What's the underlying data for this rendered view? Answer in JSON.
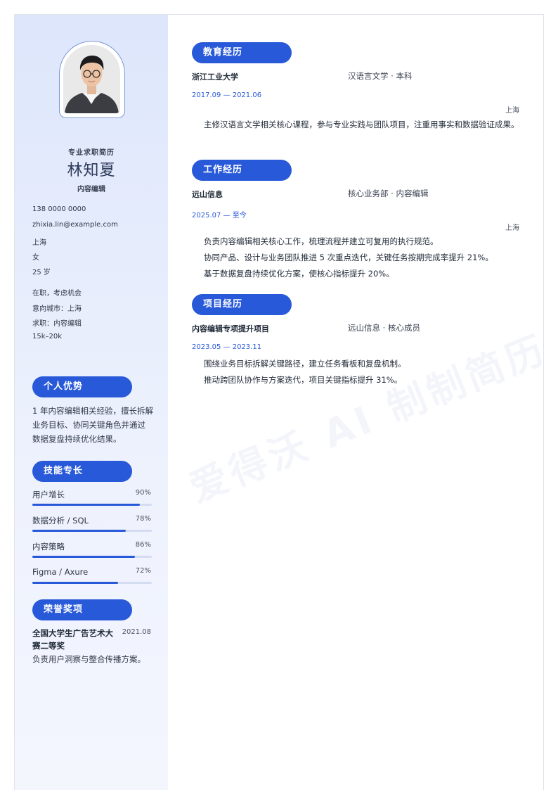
{
  "watermark": "爱得沃 AI 制制简历",
  "profile": {
    "subtitle": "专业求职简历",
    "name": "林知夏",
    "role": "内容编辑",
    "phone": "138 0000 0000",
    "email": "zhixia.lin@example.com",
    "city": "上海",
    "gender": "女",
    "age": "25 岁",
    "status": "在职，考虑机会",
    "target_city": "意向城市：上海",
    "target_job": "求职：内容编辑",
    "salary": "15k–20k"
  },
  "advantages": {
    "title": "个人优势",
    "text": "1 年内容编辑相关经验，擅长拆解业务目标、协同关键角色并通过数据复盘持续优化结果。"
  },
  "skills": {
    "title": "技能专长",
    "items": [
      {
        "name": "用户增长",
        "percent_label": "90%",
        "level": 0.9
      },
      {
        "name": "数据分析 / SQL",
        "percent_label": "78%",
        "level": 0.78
      },
      {
        "name": "内容策略",
        "percent_label": "86%",
        "level": 0.86
      },
      {
        "name": "Figma / Axure",
        "percent_label": "72%",
        "level": 0.72
      }
    ]
  },
  "awards": {
    "title": "荣誉奖项",
    "items": [
      {
        "name": "全国大学生广告艺术大赛二等奖",
        "date": "2021.08",
        "desc": "负责用户洞察与整合传播方案。"
      }
    ]
  },
  "education": {
    "title": "教育经历",
    "school": "浙江工业大学",
    "major": "汉语言文学 · 本科",
    "period": "2017.09 — 2021.06",
    "location": "上海",
    "desc": "主修汉语言文学相关核心课程，参与专业实践与团队项目，注重用事实和数据验证成果。"
  },
  "work": {
    "title": "工作经历",
    "company": "远山信息",
    "dept": "核心业务部 · 内容编辑",
    "period": "2025.07 — 至今",
    "location": "上海",
    "bullets": [
      "负责内容编辑相关核心工作，梳理流程并建立可复用的执行规范。",
      "协同产品、设计与业务团队推进 5 次重点迭代，关键任务按期完成率提升 21%。",
      "基于数据复盘持续优化方案，使核心指标提升 20%。"
    ]
  },
  "project": {
    "title": "项目经历",
    "name": "内容编辑专项提升项目",
    "org": "远山信息 · 核心成员",
    "period": "2023.05 — 2023.11",
    "bullets": [
      "围绕业务目标拆解关键路径，建立任务看板和复盘机制。",
      "推动跨团队协作与方案迭代，项目关键指标提升 31%。"
    ]
  }
}
